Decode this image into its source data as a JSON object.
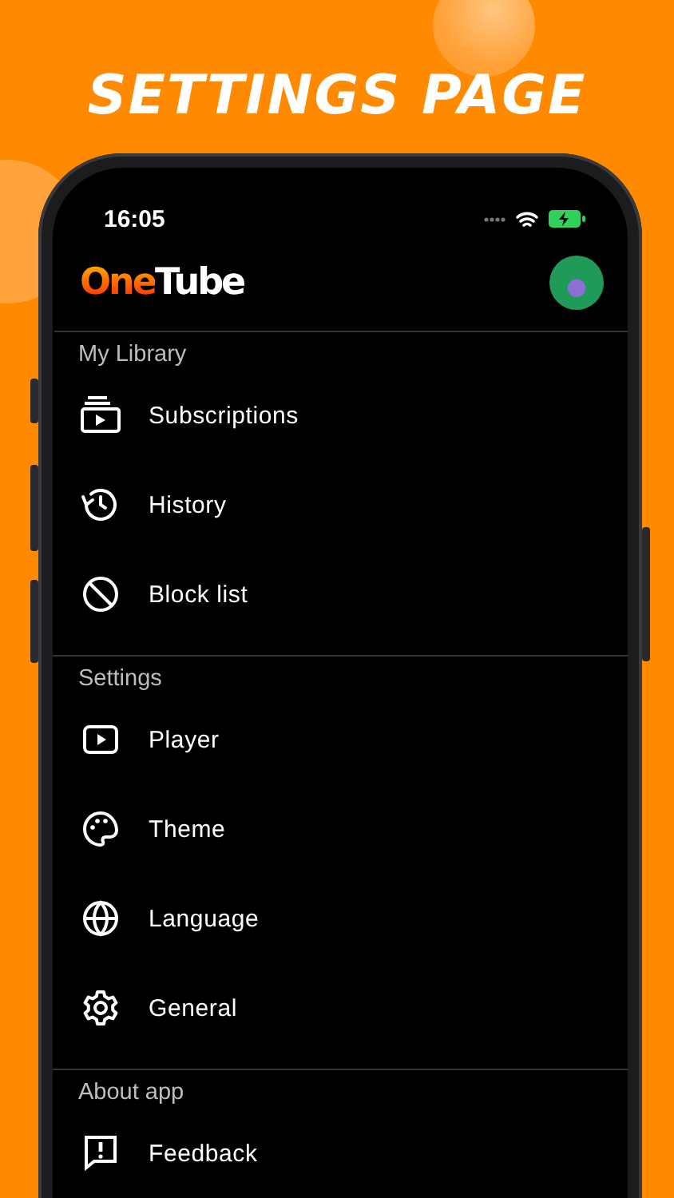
{
  "headline": "SETTINGS PAGE",
  "status_bar": {
    "time": "16:05"
  },
  "app_bar": {
    "logo_accent": "One",
    "logo_rest": "Tube"
  },
  "sections": [
    {
      "title": "My Library",
      "items": [
        {
          "label": "Subscriptions"
        },
        {
          "label": "History"
        },
        {
          "label": "Block list"
        }
      ]
    },
    {
      "title": "Settings",
      "items": [
        {
          "label": "Player"
        },
        {
          "label": "Theme"
        },
        {
          "label": "Language"
        },
        {
          "label": "General"
        }
      ]
    },
    {
      "title": "About app",
      "items": [
        {
          "label": "Feedback"
        }
      ]
    }
  ]
}
